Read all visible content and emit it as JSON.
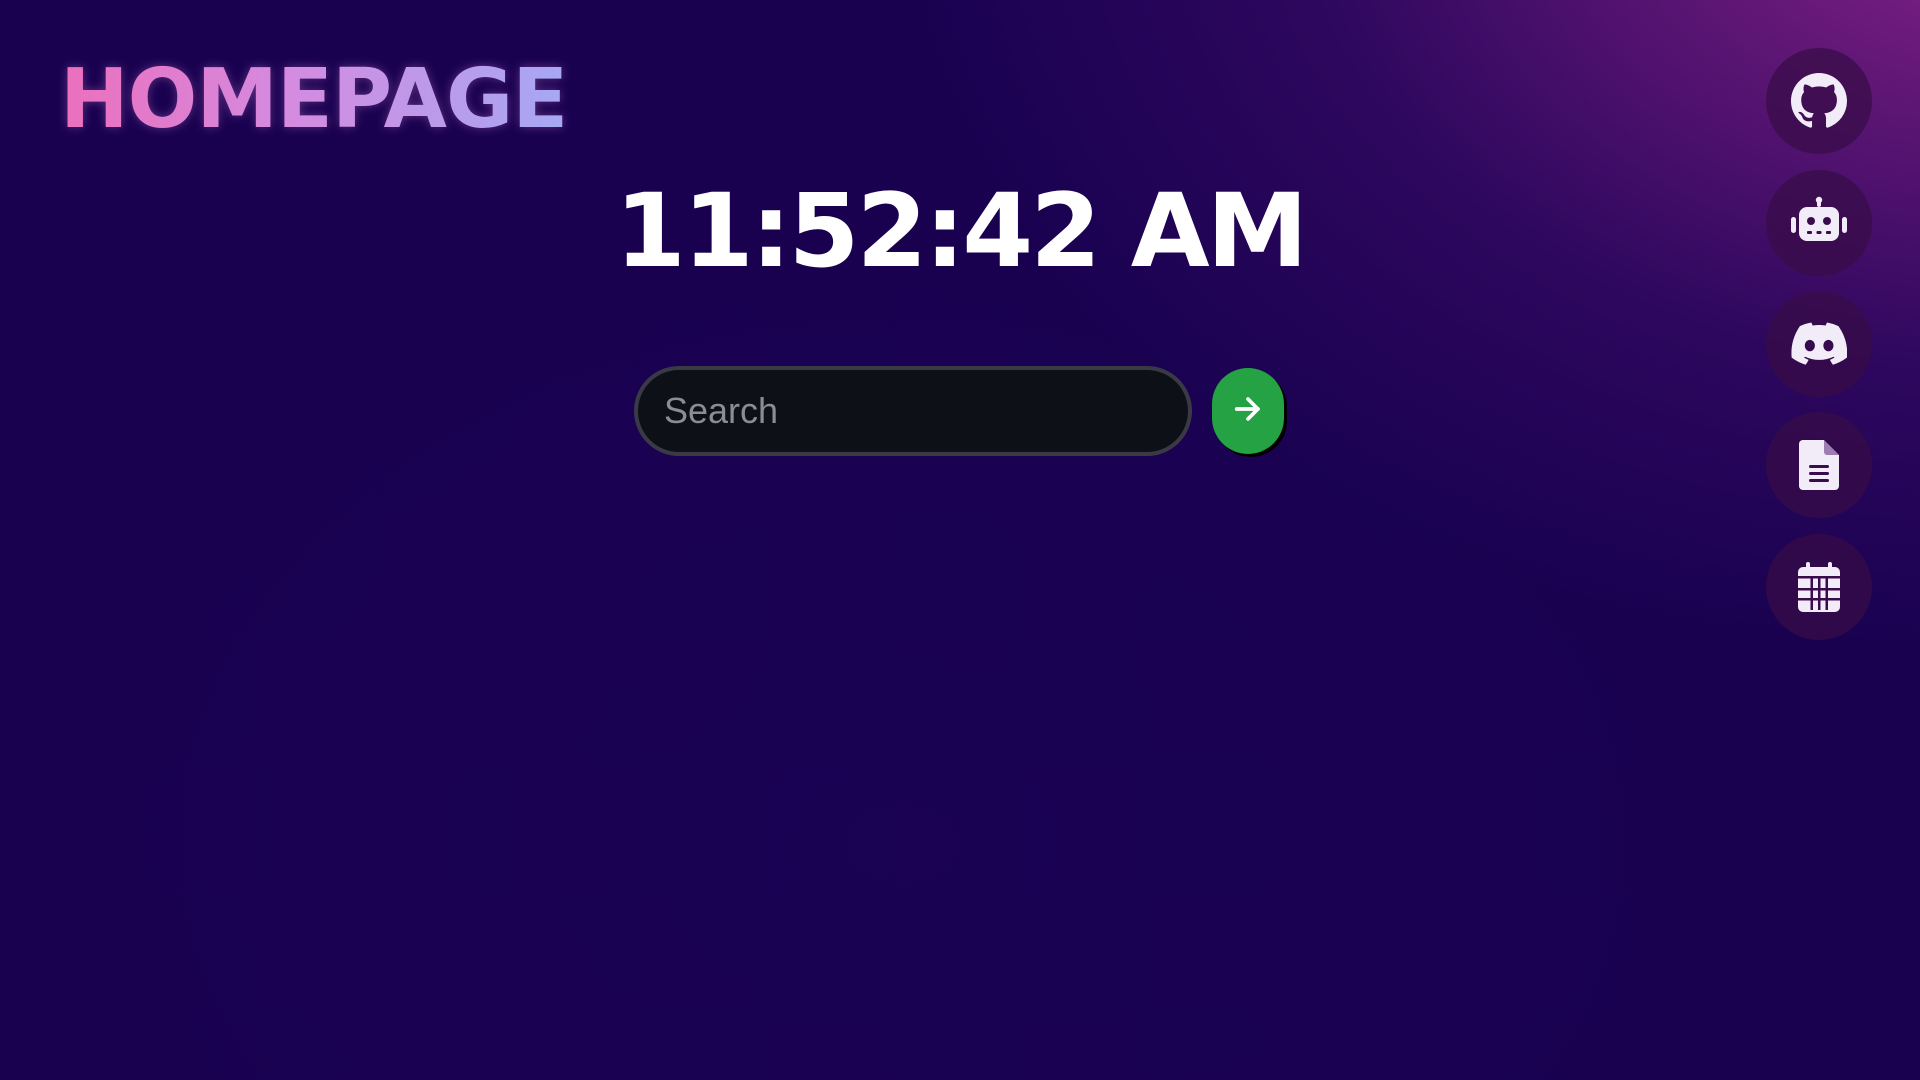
{
  "header": {
    "logo_text": "HOMEPAGE"
  },
  "clock": {
    "time": "11:52:42 AM"
  },
  "search": {
    "placeholder": "Search",
    "value": "",
    "submit_icon": "arrow-right-icon",
    "submit_color": "#25a244"
  },
  "sidebar": {
    "items": [
      {
        "id": "github",
        "icon": "github-icon"
      },
      {
        "id": "robot",
        "icon": "robot-icon"
      },
      {
        "id": "discord",
        "icon": "discord-icon"
      },
      {
        "id": "document",
        "icon": "document-icon"
      },
      {
        "id": "calendar",
        "icon": "calendar-icon"
      }
    ]
  },
  "colors": {
    "background": "#190150",
    "accent_gradient_start": "#ec6fbd",
    "accent_gradient_end": "#a6a8f4",
    "search_bg": "#0d1117"
  }
}
